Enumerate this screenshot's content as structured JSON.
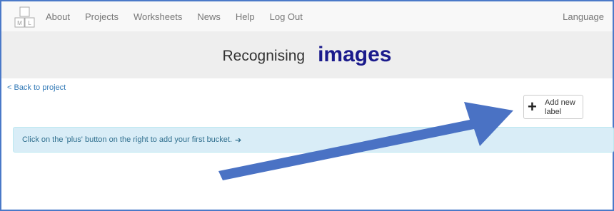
{
  "navbar": {
    "logo": {
      "letters": [
        "M",
        "L"
      ]
    },
    "links": [
      "About",
      "Projects",
      "Worksheets",
      "News",
      "Help",
      "Log Out"
    ],
    "language": "Language"
  },
  "header": {
    "prefix": "Recognising",
    "title": "images"
  },
  "back_link": "< Back to project",
  "add_button": {
    "icon": "plus-icon",
    "label": "Add new label"
  },
  "info": {
    "text": "Click on the 'plus' button on the right to add your first bucket.",
    "icon": "arrow-right-icon",
    "arrow_glyph": "➔"
  },
  "colors": {
    "frame": "#4a79c8",
    "title": "#1a1a8c",
    "link": "#337ab7",
    "info_bg": "#d9edf7",
    "annotation_arrow": "#4a72c4"
  }
}
